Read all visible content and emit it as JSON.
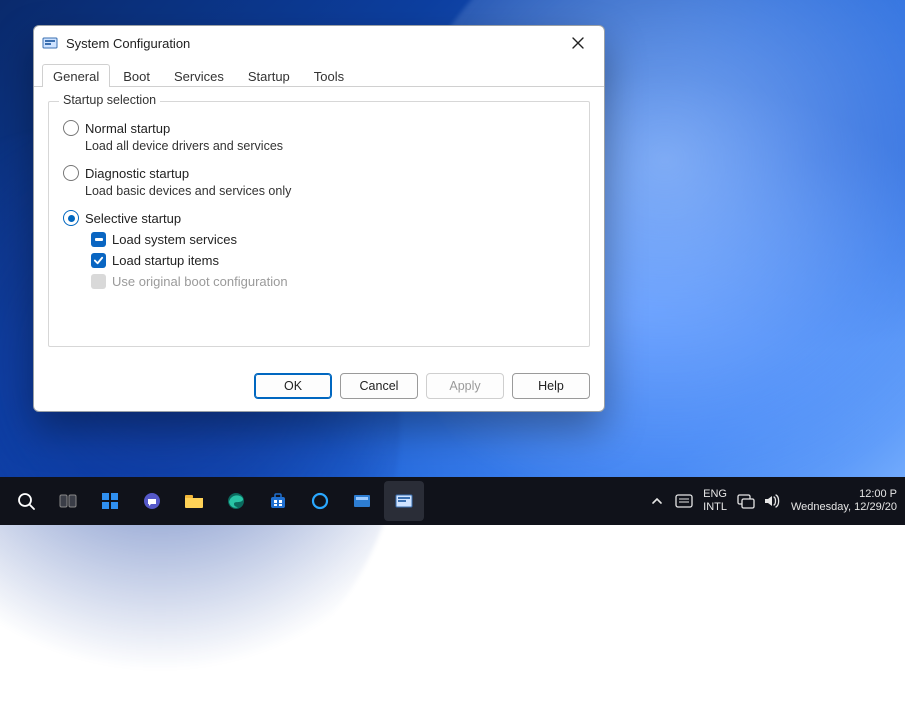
{
  "window": {
    "title": "System Configuration",
    "tabs": [
      "General",
      "Boot",
      "Services",
      "Startup",
      "Tools"
    ],
    "active_tab": 0,
    "fieldset_legend": "Startup selection",
    "options": {
      "normal": {
        "label": "Normal startup",
        "desc": "Load all device drivers and services",
        "selected": false
      },
      "diag": {
        "label": "Diagnostic startup",
        "desc": "Load basic devices and services only",
        "selected": false
      },
      "select": {
        "label": "Selective startup",
        "selected": true,
        "sub": {
          "sys": {
            "label": "Load system services",
            "state": "indeterminate"
          },
          "start": {
            "label": "Load startup items",
            "state": "checked"
          },
          "orig": {
            "label": "Use original boot configuration",
            "state": "disabled"
          }
        }
      }
    },
    "buttons": {
      "ok": "OK",
      "cancel": "Cancel",
      "apply": "Apply",
      "help": "Help"
    }
  },
  "taskbar": {
    "icons": [
      "search-icon",
      "task-view-icon",
      "widgets-icon",
      "chat-icon",
      "file-explorer-icon",
      "edge-icon",
      "store-icon",
      "cortana-icon",
      "desktop-icon",
      "msconfig-icon"
    ],
    "lang_top": "ENG",
    "lang_bottom": "INTL",
    "time": "12:00 P",
    "date": "Wednesday, 12/29/20"
  }
}
